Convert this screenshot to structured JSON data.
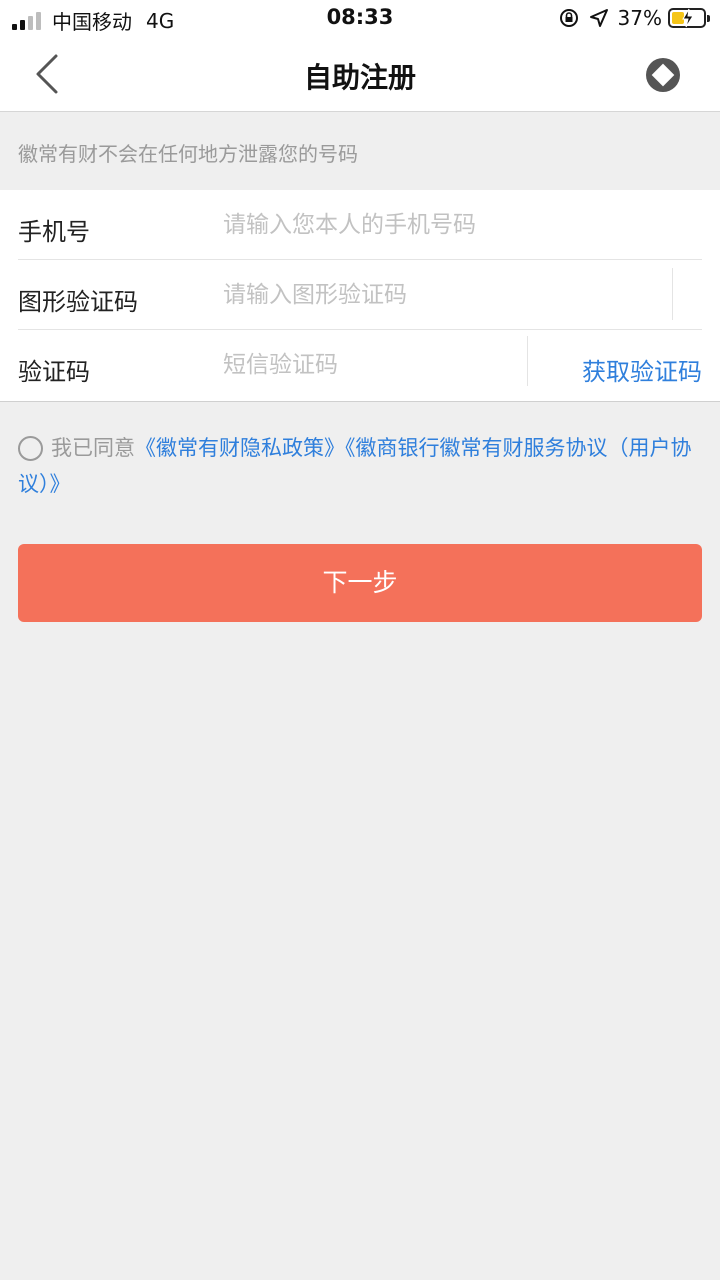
{
  "status_bar": {
    "carrier": "中国移动",
    "network": "4G",
    "time": "08:33",
    "battery": "37%"
  },
  "nav": {
    "title": "自助注册",
    "back_icon": "chevron-left-icon",
    "action_icon": "diamond-icon"
  },
  "notice": "徽常有财不会在任何地方泄露您的号码",
  "form": {
    "phone": {
      "label": "手机号",
      "placeholder": "请输入您本人的手机号码",
      "value": ""
    },
    "captcha": {
      "label": "图形验证码",
      "placeholder": "请输入图形验证码",
      "value": ""
    },
    "sms": {
      "label": "验证码",
      "placeholder": "短信验证码",
      "value": "",
      "get_code_label": "获取验证码"
    }
  },
  "agreement": {
    "prefix": "我已同意",
    "link_privacy": "《徽常有财隐私政策》",
    "link_service": "《徽商银行徽常有财服务协议（用户协议）》",
    "checked": false
  },
  "next_button": "下一步",
  "colors": {
    "primary_button": "#f4715a",
    "link": "#2f7fdc",
    "background": "#efefef"
  }
}
